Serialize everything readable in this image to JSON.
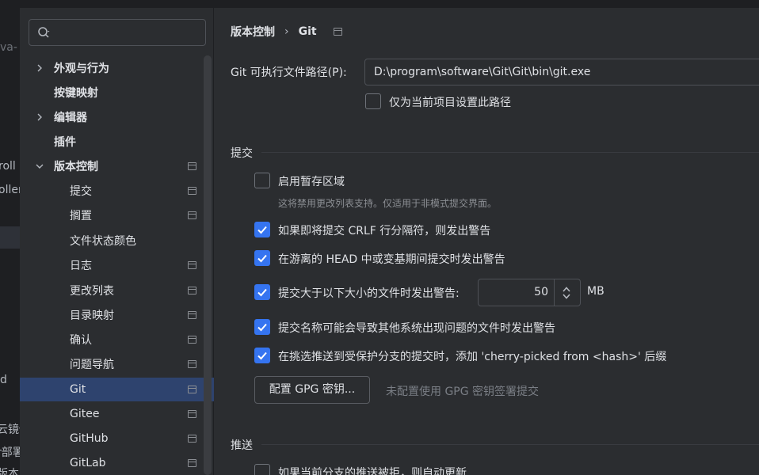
{
  "background_fragments": [
    "va-",
    "roll",
    "oller",
    "d",
    "云镜你",
    "r部署",
    "版本"
  ],
  "sidebar": {
    "search_placeholder": "",
    "items": [
      {
        "label": "外观与行为",
        "expandable": true,
        "bold": true
      },
      {
        "label": "按键映射",
        "expandable": false,
        "bold": true
      },
      {
        "label": "编辑器",
        "expandable": true,
        "bold": true
      },
      {
        "label": "插件",
        "expandable": false,
        "bold": true
      },
      {
        "label": "版本控制",
        "expanded": true,
        "bold": true,
        "has_page_icon": true
      },
      {
        "label": "提交",
        "has_page_icon": true
      },
      {
        "label": "搁置",
        "has_page_icon": true
      },
      {
        "label": "文件状态颜色",
        "has_page_icon": false
      },
      {
        "label": "日志",
        "has_page_icon": true
      },
      {
        "label": "更改列表",
        "has_page_icon": true
      },
      {
        "label": "目录映射",
        "has_page_icon": true
      },
      {
        "label": "确认",
        "has_page_icon": true
      },
      {
        "label": "问题导航",
        "has_page_icon": true
      },
      {
        "label": "Git",
        "has_page_icon": true,
        "selected": true
      },
      {
        "label": "Gitee",
        "has_page_icon": true
      },
      {
        "label": "GitHub",
        "has_page_icon": true
      },
      {
        "label": "GitLab",
        "has_page_icon": true
      }
    ]
  },
  "breadcrumb": {
    "parent": "版本控制",
    "separator": "›",
    "current": "Git"
  },
  "git_path": {
    "label": "Git 可执行文件路径(P):",
    "value": "D:\\program\\software\\Git\\Git\\bin\\git.exe",
    "project_only_label": "仅为当前项目设置此路径",
    "project_only_checked": false
  },
  "commit_section": {
    "title": "提交",
    "staging_label": "启用暂存区域",
    "staging_checked": false,
    "staging_hint": "这将禁用更改列表支持。仅适用于非模式提交界面。",
    "crlf_label": "如果即将提交 CRLF 行分隔符，则发出警告",
    "crlf_checked": true,
    "detached_label": "在游离的 HEAD 中或变基期间提交时发出警告",
    "detached_checked": true,
    "large_file_label": "提交大于以下大小的文件时发出警告:",
    "large_file_checked": true,
    "large_file_value": "50",
    "large_file_unit": "MB",
    "bad_names_label": "提交名称可能会导致其他系统出现问题的文件时发出警告",
    "bad_names_checked": true,
    "cherry_label": "在挑选推送到受保护分支的提交时，添加 'cherry-picked from <hash>' 后缀",
    "cherry_checked": true,
    "gpg_button": "配置 GPG 密钥...",
    "gpg_status": "未配置使用 GPG 密钥签署提交"
  },
  "push_section": {
    "title": "推送",
    "auto_update_label": "如果当前分支的推送被拒，则自动更新",
    "auto_update_checked": false
  },
  "colors": {
    "accent": "#3574f0",
    "selection": "#2e436e",
    "panel": "#2b2d30",
    "text": "#dfe1e5",
    "muted": "#8c8f94"
  }
}
